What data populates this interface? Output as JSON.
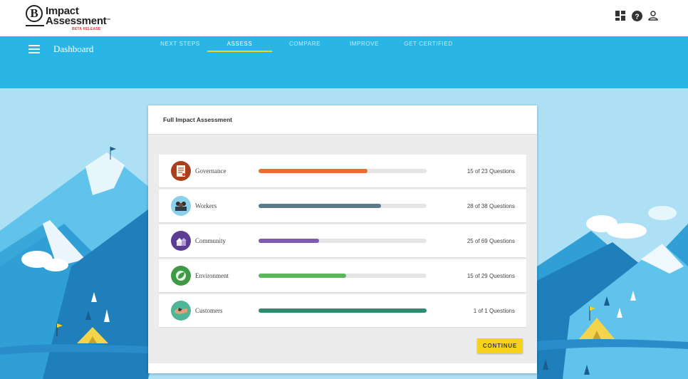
{
  "app": {
    "logo_line1": "Impact",
    "logo_line2": "Assessment",
    "logo_tm": "™",
    "logo_badge": "BETA RELEASE",
    "logo_letter": "B"
  },
  "top_icons": [
    "dashboard-grid-icon",
    "help-icon",
    "user-icon"
  ],
  "header": {
    "title": "Dashboard",
    "menu_icon": "hamburger-menu-icon"
  },
  "tabs": [
    {
      "label": "NEXT STEPS",
      "active": false
    },
    {
      "label": "ASSESS",
      "active": true
    },
    {
      "label": "COMPARE",
      "active": false
    },
    {
      "label": "IMPROVE",
      "active": false
    },
    {
      "label": "GET CERTIFIED",
      "active": false
    }
  ],
  "card": {
    "title": "Full Impact Assessment",
    "continue_label": "CONTINUE"
  },
  "categories": [
    {
      "label": "Governance",
      "count": "15 of 23 Questions",
      "progress": 0.65,
      "color": "#ec6d2e",
      "icon": "document-certificate-icon",
      "icon_bg": "#a8401e"
    },
    {
      "label": "Workers",
      "count": "28 of 38 Questions",
      "progress": 0.73,
      "color": "#5a7b89",
      "icon": "workers-group-icon",
      "icon_bg": "#8ad0ea"
    },
    {
      "label": "Community",
      "count": "25 of 69 Questions",
      "progress": 0.36,
      "color": "#7e5bb0",
      "icon": "community-houses-icon",
      "icon_bg": "#5b3d93"
    },
    {
      "label": "Environment",
      "count": "15 of 29 Questions",
      "progress": 0.52,
      "color": "#5cb75c",
      "icon": "environment-leaf-icon",
      "icon_bg": "#3f9a48"
    },
    {
      "label": "Customers",
      "count": "1 of 1 Questions",
      "progress": 1.0,
      "color": "#2f8a72",
      "icon": "customers-handshake-icon",
      "icon_bg": "#4fb597"
    }
  ]
}
